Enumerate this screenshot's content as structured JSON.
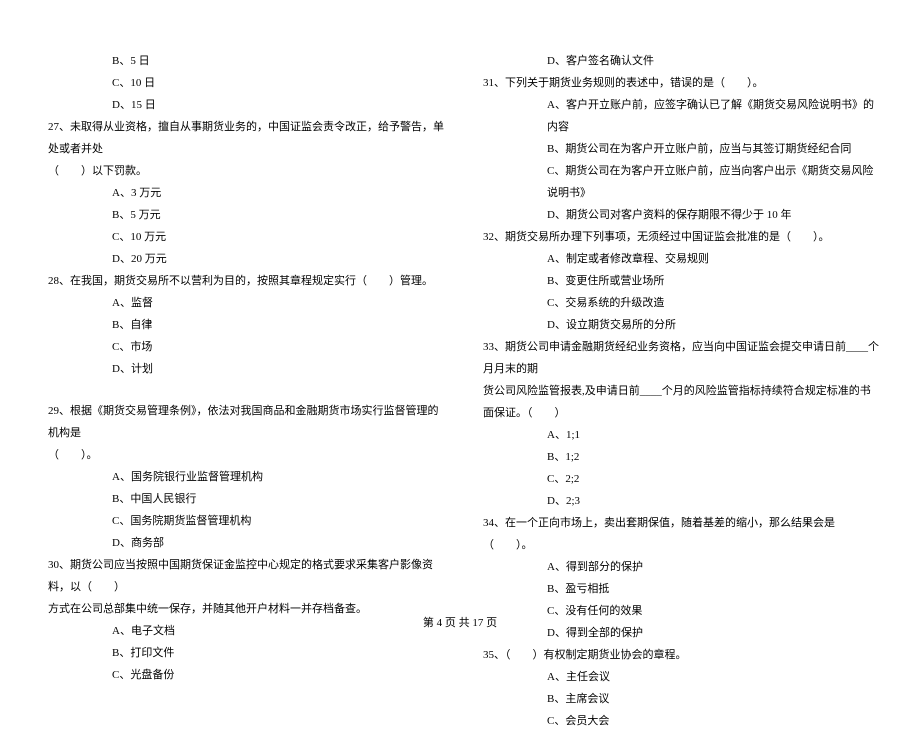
{
  "left": {
    "opt_b_pre": "B、5 日",
    "opt_c_pre": "C、10 日",
    "opt_d_pre": "D、15 日",
    "q27_line1": "27、未取得从业资格，擅自从事期货业务的，中国证监会责令改正，给予警告，单处或者并处",
    "q27_line2": "（　　）以下罚款。",
    "q27_a": "A、3 万元",
    "q27_b": "B、5 万元",
    "q27_c": "C、10 万元",
    "q27_d": "D、20 万元",
    "q28": "28、在我国，期货交易所不以营利为目的，按照其章程规定实行（　　）管理。",
    "q28_a": "A、监督",
    "q28_b": "B、自律",
    "q28_c": "C、市场",
    "q28_d": "D、计划",
    "q29_line1": "29、根据《期货交易管理条例》，依法对我国商品和金融期货市场实行监督管理的机构是",
    "q29_line2": "（　　）。",
    "q29_a": "A、国务院银行业监督管理机构",
    "q29_b": "B、中国人民银行",
    "q29_c": "C、国务院期货监督管理机构",
    "q29_d": "D、商务部",
    "q30_line1": "30、期货公司应当按照中国期货保证金监控中心规定的格式要求采集客户影像资料，以（　　）",
    "q30_line2": "方式在公司总部集中统一保存，并随其他开户材料一并存档备查。",
    "q30_a": "A、电子文档",
    "q30_b": "B、打印文件",
    "q30_c": "C、光盘备份"
  },
  "right": {
    "opt_d_pre": "D、客户签名确认文件",
    "q31": "31、下列关于期货业务规则的表述中，错误的是（　　）。",
    "q31_a": "A、客户开立账户前，应签字确认已了解《期货交易风险说明书》的内容",
    "q31_b": "B、期货公司在为客户开立账户前，应当与其签订期货经纪合同",
    "q31_c": "C、期货公司在为客户开立账户前，应当向客户出示《期货交易风险说明书》",
    "q31_d": "D、期货公司对客户资料的保存期限不得少于 10 年",
    "q32": "32、期货交易所办理下列事项，无须经过中国证监会批准的是（　　）。",
    "q32_a": "A、制定或者修改章程、交易规则",
    "q32_b": "B、变更住所或营业场所",
    "q32_c": "C、交易系统的升级改造",
    "q32_d": "D、设立期货交易所的分所",
    "q33_line1": "33、期货公司申请金融期货经纪业务资格，应当向中国证监会提交申请日前____个月月末的期",
    "q33_line2": "货公司风险监管报表,及申请日前____个月的风险监管指标持续符合规定标准的书面保证。（　　）",
    "q33_a": "A、1;1",
    "q33_b": "B、1;2",
    "q33_c": "C、2;2",
    "q33_d": "D、2;3",
    "q34": "34、在一个正向市场上，卖出套期保值，随着基差的缩小，那么结果会是（　　）。",
    "q34_a": "A、得到部分的保护",
    "q34_b": "B、盈亏相抵",
    "q34_c": "C、没有任何的效果",
    "q34_d": "D、得到全部的保护",
    "q35": "35、（　　）有权制定期货业协会的章程。",
    "q35_a": "A、主任会议",
    "q35_b": "B、主席会议",
    "q35_c": "C、会员大会"
  },
  "footer": "第 4 页 共 17 页"
}
